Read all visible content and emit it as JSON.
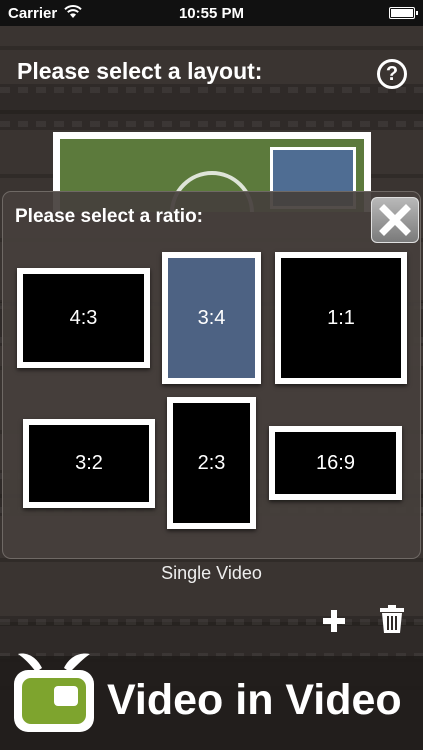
{
  "status_bar": {
    "carrier": "Carrier",
    "time": "10:55 PM"
  },
  "header": {
    "title": "Please select a layout:",
    "help_icon": "?"
  },
  "modal": {
    "title": "Please select a ratio:",
    "ratios": [
      {
        "label": "4:3",
        "selected": false
      },
      {
        "label": "3:4",
        "selected": true
      },
      {
        "label": "1:1",
        "selected": false
      },
      {
        "label": "3:2",
        "selected": false
      },
      {
        "label": "2:3",
        "selected": false
      },
      {
        "label": "16:9",
        "selected": false
      }
    ]
  },
  "layout": {
    "caption": "Single Video"
  },
  "toolbar": {
    "add_icon": "plus-icon",
    "delete_icon": "trash-icon"
  },
  "banner": {
    "text": "Video in Video",
    "logo_icon": "tv-logo-icon"
  },
  "colors": {
    "selected_ratio": "#4d6283",
    "logo_green": "#7ea42e",
    "background": "#3a3431"
  }
}
